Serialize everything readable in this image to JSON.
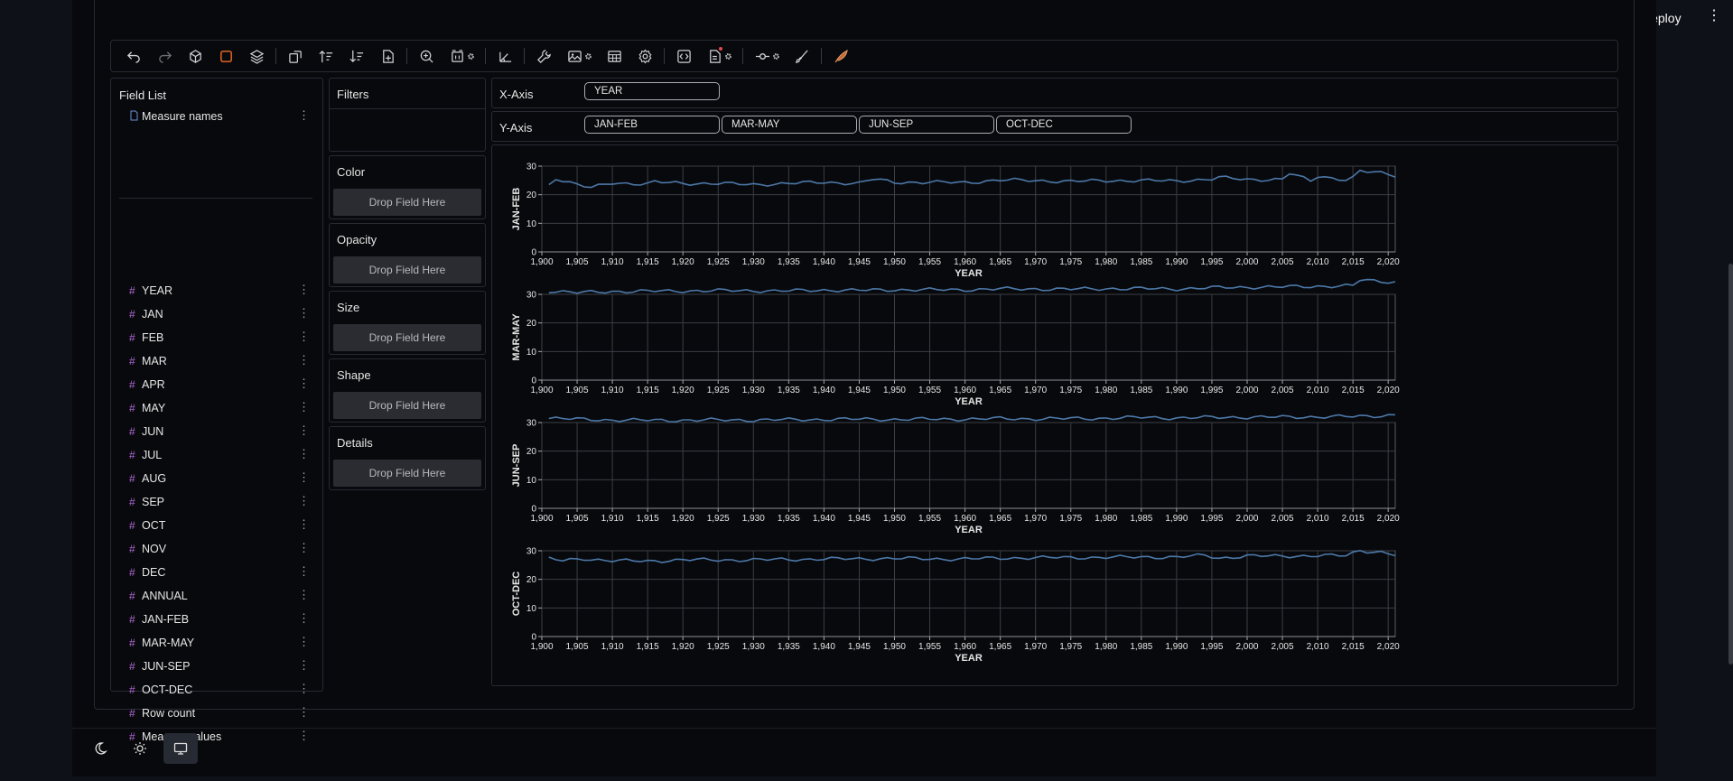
{
  "header": {
    "deploy_label": "Deploy"
  },
  "toolbar": {
    "items": [
      "undo-icon",
      "redo-icon",
      "cube-icon",
      "mark-icon",
      "layers-icon",
      "sep",
      "transpose-icon",
      "sort-asc-icon",
      "sort-desc-icon",
      "add-file-icon",
      "sep",
      "zoom-in-icon",
      "resize-icon",
      "gear-sm",
      "sep",
      "axis-icon",
      "sep",
      "wrench-icon",
      "image-icon",
      "gear-sm",
      "table-icon",
      "settings-icon",
      "sep",
      "code-icon",
      "export-icon",
      "gear-sm",
      "sep",
      "commit-icon",
      "gear-sm",
      "brush-icon",
      "sep",
      "feather-icon"
    ]
  },
  "field_list": {
    "title": "Field List",
    "dimension": "Measure names",
    "measures": [
      "YEAR",
      "JAN",
      "FEB",
      "MAR",
      "APR",
      "MAY",
      "JUN",
      "JUL",
      "AUG",
      "SEP",
      "OCT",
      "NOV",
      "DEC",
      "ANNUAL",
      "JAN-FEB",
      "MAR-MAY",
      "JUN-SEP",
      "OCT-DEC",
      "Row count",
      "Measure values"
    ]
  },
  "encodings": {
    "filters": "Filters",
    "color": "Color",
    "opacity": "Opacity",
    "size": "Size",
    "shape": "Shape",
    "details": "Details",
    "drop_label": "Drop Field Here"
  },
  "axes": {
    "x_label": "X-Axis",
    "x_fields": [
      "YEAR"
    ],
    "y_label": "Y-Axis",
    "y_fields": [
      "JAN-FEB",
      "MAR-MAY",
      "JUN-SEP",
      "OCT-DEC"
    ]
  },
  "chart_data": {
    "type": "line",
    "xlabel": "YEAR",
    "x_start": 1901,
    "x_end": 2021,
    "xlim": [
      1900,
      2021
    ],
    "x_ticks": [
      "1,900",
      "1,905",
      "1,910",
      "1,915",
      "1,920",
      "1,925",
      "1,930",
      "1,935",
      "1,940",
      "1,945",
      "1,950",
      "1,955",
      "1,960",
      "1,965",
      "1,970",
      "1,975",
      "1,980",
      "1,985",
      "1,990",
      "1,995",
      "2,000",
      "2,005",
      "2,010",
      "2,015",
      "2,020"
    ],
    "y_ticks": [
      0,
      10,
      20,
      30
    ],
    "ylim": [
      0,
      30
    ],
    "grid": true,
    "color": "#4c78a8",
    "series": [
      {
        "name": "JAN-FEB",
        "anchors": [
          [
            1901,
            23.3
          ],
          [
            1902,
            25.8
          ],
          [
            1905,
            23.6
          ],
          [
            1907,
            22.4
          ],
          [
            1910,
            24.1
          ],
          [
            1915,
            23.8
          ],
          [
            1916,
            24.5
          ],
          [
            1920,
            23.9
          ],
          [
            1925,
            24.0
          ],
          [
            1930,
            23.5
          ],
          [
            1935,
            24.0
          ],
          [
            1940,
            24.3
          ],
          [
            1945,
            24.0
          ],
          [
            1947,
            25.5
          ],
          [
            1950,
            24.3
          ],
          [
            1955,
            24.4
          ],
          [
            1960,
            24.2
          ],
          [
            1965,
            25.2
          ],
          [
            1970,
            24.9
          ],
          [
            1975,
            24.7
          ],
          [
            1980,
            24.9
          ],
          [
            1985,
            25.0
          ],
          [
            1990,
            24.8
          ],
          [
            1995,
            25.5
          ],
          [
            1996,
            26.0
          ],
          [
            2000,
            25.3
          ],
          [
            2005,
            25.4
          ],
          [
            2006,
            27.5
          ],
          [
            2009,
            24.8
          ],
          [
            2010,
            26.5
          ],
          [
            2014,
            25.3
          ],
          [
            2015,
            25.9
          ],
          [
            2016,
            28.2
          ],
          [
            2019,
            27.6
          ],
          [
            2021,
            26.8
          ]
        ]
      },
      {
        "name": "MAR-MAY",
        "anchors": [
          [
            1901,
            31.2
          ],
          [
            1905,
            30.6
          ],
          [
            1910,
            31.0
          ],
          [
            1915,
            31.1
          ],
          [
            1920,
            31.2
          ],
          [
            1925,
            31.3
          ],
          [
            1930,
            31.3
          ],
          [
            1935,
            31.2
          ],
          [
            1940,
            31.5
          ],
          [
            1945,
            31.4
          ],
          [
            1950,
            31.6
          ],
          [
            1955,
            31.6
          ],
          [
            1960,
            31.6
          ],
          [
            1965,
            31.9
          ],
          [
            1970,
            31.9
          ],
          [
            1975,
            31.8
          ],
          [
            1980,
            32.0
          ],
          [
            1985,
            32.0
          ],
          [
            1990,
            31.9
          ],
          [
            1995,
            32.3
          ],
          [
            2000,
            32.5
          ],
          [
            2005,
            32.6
          ],
          [
            2010,
            32.8
          ],
          [
            2015,
            33.0
          ],
          [
            2016,
            35.0
          ],
          [
            2021,
            34.3
          ]
        ]
      },
      {
        "name": "JUN-SEP",
        "anchors": [
          [
            1901,
            31.5
          ],
          [
            1905,
            31.2
          ],
          [
            1910,
            30.9
          ],
          [
            1915,
            30.8
          ],
          [
            1920,
            30.8
          ],
          [
            1925,
            30.9
          ],
          [
            1930,
            30.9
          ],
          [
            1935,
            31.0
          ],
          [
            1940,
            31.1
          ],
          [
            1945,
            31.2
          ],
          [
            1950,
            31.1
          ],
          [
            1955,
            31.2
          ],
          [
            1960,
            31.2
          ],
          [
            1965,
            31.4
          ],
          [
            1970,
            31.3
          ],
          [
            1975,
            31.4
          ],
          [
            1980,
            31.5
          ],
          [
            1985,
            31.8
          ],
          [
            1990,
            31.6
          ],
          [
            1995,
            31.8
          ],
          [
            2000,
            31.9
          ],
          [
            2005,
            31.9
          ],
          [
            2010,
            32.0
          ],
          [
            2015,
            32.1
          ],
          [
            2019,
            32.4
          ],
          [
            2021,
            32.7
          ]
        ]
      },
      {
        "name": "OCT-DEC",
        "anchors": [
          [
            1901,
            27.3
          ],
          [
            1903,
            26.5
          ],
          [
            1906,
            27.2
          ],
          [
            1910,
            26.6
          ],
          [
            1915,
            26.3
          ],
          [
            1920,
            26.9
          ],
          [
            1925,
            26.7
          ],
          [
            1930,
            26.9
          ],
          [
            1935,
            26.9
          ],
          [
            1940,
            27.2
          ],
          [
            1945,
            27.1
          ],
          [
            1950,
            27.4
          ],
          [
            1955,
            27.1
          ],
          [
            1960,
            27.2
          ],
          [
            1965,
            27.4
          ],
          [
            1970,
            27.6
          ],
          [
            1975,
            27.6
          ],
          [
            1980,
            27.7
          ],
          [
            1985,
            27.8
          ],
          [
            1990,
            27.8
          ],
          [
            1994,
            28.4
          ],
          [
            1996,
            27.4
          ],
          [
            2000,
            28.2
          ],
          [
            2005,
            28.1
          ],
          [
            2010,
            28.3
          ],
          [
            2014,
            28.3
          ],
          [
            2016,
            30.1
          ],
          [
            2019,
            29.5
          ],
          [
            2021,
            28.5
          ]
        ]
      }
    ]
  },
  "bottom_bar": {
    "items": [
      "moon-icon",
      "sun-icon",
      "monitor-icon"
    ]
  }
}
